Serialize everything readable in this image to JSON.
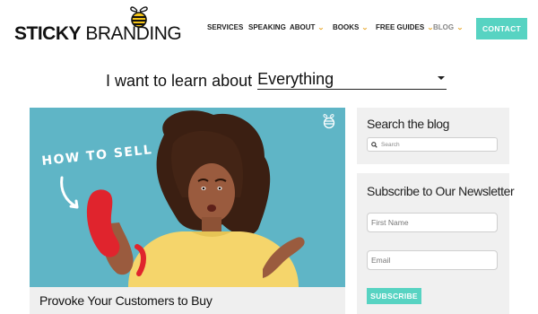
{
  "logo": {
    "word1": "STICKY",
    "word2": "BRANDING"
  },
  "nav": {
    "items": [
      {
        "label": "SERVICES",
        "dropdown": false
      },
      {
        "label": "SPEAKING",
        "dropdown": false
      },
      {
        "label": "ABOUT",
        "dropdown": true
      },
      {
        "label": "BOOKS",
        "dropdown": true
      },
      {
        "label": "FREE GUIDES",
        "dropdown": true
      },
      {
        "label": "BLOG",
        "dropdown": true
      }
    ],
    "contact_label": "CONTACT"
  },
  "learn": {
    "label": "I want to learn about",
    "selected": "Everything"
  },
  "hero": {
    "overlay_text": "HOW TO SELL",
    "post_title": "Provoke Your Customers to Buy"
  },
  "sidebar": {
    "search_heading": "Search the blog",
    "search_placeholder": "Search",
    "newsletter_heading": "Subscribe to Our Newsletter",
    "first_name_placeholder": "First Name",
    "email_placeholder": "Email",
    "subscribe_label": "SUBSCRIBE"
  },
  "colors": {
    "accent": "#57d3c2",
    "hero_bg": "#5fb5c6",
    "bee_yellow": "#f5c518",
    "chevron": "#e8a21b"
  }
}
